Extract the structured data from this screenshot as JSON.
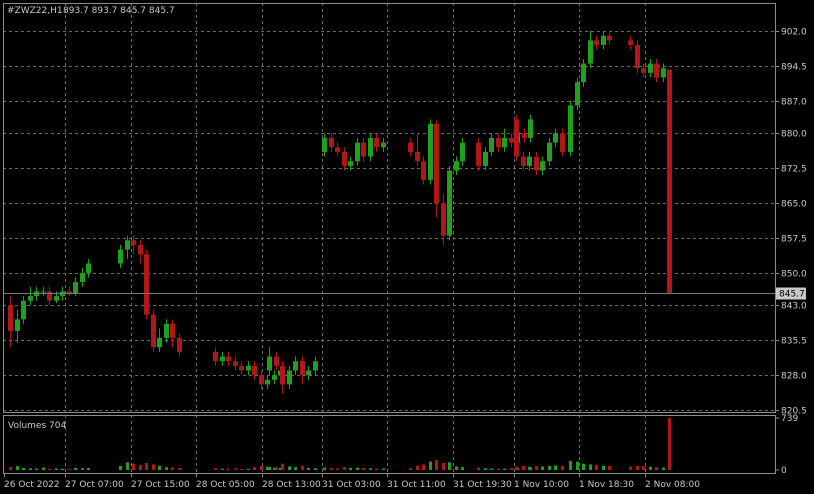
{
  "window": {
    "symbol_label": "#ZWZ22,H1",
    "ohlc_label": "893.7 893.7 845.7 845.7",
    "volume_label": "Volumes 704"
  },
  "colors": {
    "background": "#000000",
    "grid": "#6a6a6a",
    "frame": "#8c8c8c",
    "bull": "#1fa01f",
    "bear": "#b01818",
    "price_line": "#7a7a7a"
  },
  "chart_data": {
    "type": "candlestick",
    "price_axis": {
      "ticks": [
        "902.0",
        "894.5",
        "887.0",
        "880.0",
        "872.5",
        "865.0",
        "857.5",
        "850.0",
        "843.0",
        "835.5",
        "828.0",
        "820.5"
      ],
      "range": [
        820.5,
        902.0
      ],
      "current": "845.7"
    },
    "volume_axis": {
      "ticks": [
        "739",
        "0"
      ],
      "max": 739
    },
    "time_axis": {
      "ticks": [
        "26 Oct 2022",
        "27 Oct 07:00",
        "27 Oct 15:00",
        "28 Oct 05:00",
        "28 Oct 13:00",
        "31 Oct 03:00",
        "31 Oct 11:00",
        "31 Oct 19:30",
        "1 Nov 10:00",
        "1 Nov 18:30",
        "2 Nov 08:00"
      ]
    },
    "grid": true,
    "candles": [
      [
        843,
        837.5,
        845,
        834,
        40,
        "s1"
      ],
      [
        837.5,
        840,
        842,
        835,
        55,
        ""
      ],
      [
        840,
        844,
        845,
        839,
        30,
        ""
      ],
      [
        844,
        845,
        847,
        843,
        25,
        ""
      ],
      [
        845,
        846,
        847,
        844,
        20,
        ""
      ],
      [
        846,
        846,
        847,
        845,
        35,
        ""
      ],
      [
        846,
        844,
        847,
        843,
        15,
        ""
      ],
      [
        844,
        845,
        846,
        843.5,
        22,
        ""
      ],
      [
        845,
        846,
        847,
        844,
        18,
        ""
      ],
      [
        846,
        845.5,
        847,
        845,
        12,
        ""
      ],
      [
        845.5,
        848,
        849,
        845,
        30,
        ""
      ],
      [
        848,
        850,
        851,
        847,
        25,
        ""
      ],
      [
        850,
        852,
        853,
        849,
        28,
        ""
      ],
      [
        852,
        855,
        856,
        851,
        60,
        "s2"
      ],
      [
        855,
        857,
        858,
        853,
        110,
        ""
      ],
      [
        857,
        856,
        858,
        854,
        90,
        ""
      ],
      [
        856,
        854,
        857,
        852,
        70,
        ""
      ],
      [
        854,
        841,
        855,
        840,
        100,
        ""
      ],
      [
        841,
        834,
        842,
        833,
        80,
        ""
      ],
      [
        834,
        836,
        838,
        833,
        60,
        ""
      ],
      [
        836,
        839,
        840,
        835,
        40,
        ""
      ],
      [
        839,
        836,
        840,
        834,
        35,
        ""
      ],
      [
        836,
        833,
        837,
        832,
        30,
        ""
      ],
      [
        833,
        831,
        834,
        830,
        25,
        "s3"
      ],
      [
        831,
        832,
        833,
        830,
        20,
        ""
      ],
      [
        832,
        831,
        833,
        830,
        18,
        ""
      ],
      [
        831,
        830,
        832,
        829,
        22,
        ""
      ],
      [
        830,
        829,
        831,
        828,
        15,
        ""
      ],
      [
        829,
        830,
        831,
        828,
        18,
        ""
      ],
      [
        830,
        828,
        831,
        827,
        40,
        ""
      ],
      [
        828,
        826,
        829,
        825,
        60,
        ""
      ],
      [
        826,
        827,
        828,
        825,
        45,
        ""
      ],
      [
        827,
        828,
        829,
        826,
        35,
        ""
      ],
      [
        828,
        829,
        830,
        827,
        30,
        ""
      ],
      [
        829,
        832,
        834,
        828,
        45,
        "s4"
      ],
      [
        832,
        830,
        833,
        829,
        40,
        ""
      ],
      [
        830,
        826,
        831,
        824,
        90,
        ""
      ],
      [
        826,
        829,
        830,
        825,
        50,
        ""
      ],
      [
        829,
        831,
        832,
        828,
        40,
        ""
      ],
      [
        831,
        828,
        832,
        826,
        60,
        ""
      ],
      [
        828,
        829,
        830,
        827,
        30,
        ""
      ],
      [
        829,
        831,
        832,
        828,
        25,
        ""
      ],
      [
        876,
        879,
        880,
        875,
        35,
        "s5"
      ],
      [
        879,
        877,
        880,
        876,
        25,
        ""
      ],
      [
        877,
        876,
        878,
        875,
        20,
        ""
      ],
      [
        876,
        873,
        877,
        872,
        40,
        ""
      ],
      [
        873,
        874,
        875,
        872,
        30,
        ""
      ],
      [
        874,
        878,
        879,
        873,
        35,
        ""
      ],
      [
        878,
        875,
        879,
        874,
        30,
        ""
      ],
      [
        875,
        879,
        880,
        874,
        25,
        ""
      ],
      [
        879,
        877,
        880,
        876,
        20,
        ""
      ],
      [
        877,
        878,
        879,
        876,
        22,
        ""
      ],
      [
        878,
        876,
        879,
        875,
        25,
        "s6"
      ],
      [
        876,
        874,
        880,
        873,
        60,
        ""
      ],
      [
        874,
        870,
        875,
        869,
        80,
        ""
      ],
      [
        870,
        882,
        883,
        869,
        120,
        ""
      ],
      [
        882,
        865,
        883,
        862,
        140,
        ""
      ],
      [
        865,
        858,
        867,
        856,
        100,
        ""
      ],
      [
        858,
        872,
        873,
        857,
        110,
        ""
      ],
      [
        872,
        874,
        875,
        871,
        50,
        ""
      ],
      [
        874,
        878,
        879,
        873,
        40,
        ""
      ],
      [
        878,
        873,
        879,
        872,
        35,
        "s7"
      ],
      [
        873,
        876,
        877,
        872,
        25,
        ""
      ],
      [
        876,
        879,
        880,
        875,
        22,
        ""
      ],
      [
        879,
        877,
        880,
        876,
        18,
        ""
      ],
      [
        877,
        879,
        881,
        876,
        20,
        ""
      ],
      [
        879,
        878,
        880,
        877,
        25,
        ""
      ],
      [
        878,
        880,
        881,
        877,
        28,
        ""
      ],
      [
        880,
        879,
        881,
        878,
        20,
        ""
      ],
      [
        879,
        883,
        884,
        878,
        35,
        ""
      ],
      [
        883,
        875,
        884,
        874,
        50,
        "s8"
      ],
      [
        875,
        873,
        876,
        872,
        60,
        ""
      ],
      [
        873,
        875,
        876,
        872,
        45,
        ""
      ],
      [
        875,
        872,
        876,
        871,
        55,
        ""
      ],
      [
        872,
        874,
        875,
        871,
        50,
        ""
      ],
      [
        874,
        878,
        879,
        873,
        60,
        ""
      ],
      [
        878,
        880,
        881,
        877,
        65,
        ""
      ],
      [
        880,
        876,
        881,
        875,
        60,
        ""
      ],
      [
        876,
        886,
        887,
        875,
        130,
        "s9"
      ],
      [
        886,
        891,
        892,
        885,
        120,
        ""
      ],
      [
        891,
        895,
        896,
        890,
        90,
        ""
      ],
      [
        895,
        900,
        902,
        894,
        80,
        ""
      ],
      [
        900,
        899,
        901,
        898,
        70,
        ""
      ],
      [
        899,
        901,
        902,
        898,
        60,
        ""
      ],
      [
        901,
        900,
        902,
        899,
        55,
        ""
      ],
      [
        900,
        899,
        901,
        898,
        50,
        "s10"
      ],
      [
        899,
        894,
        900,
        893,
        60,
        ""
      ],
      [
        894,
        893,
        895,
        892,
        55,
        ""
      ],
      [
        893,
        895,
        896,
        892,
        45,
        ""
      ],
      [
        895,
        892,
        896,
        891,
        40,
        ""
      ],
      [
        892,
        894,
        895,
        891,
        35,
        ""
      ],
      [
        893.7,
        845.7,
        893.7,
        845.7,
        739,
        ""
      ]
    ]
  }
}
